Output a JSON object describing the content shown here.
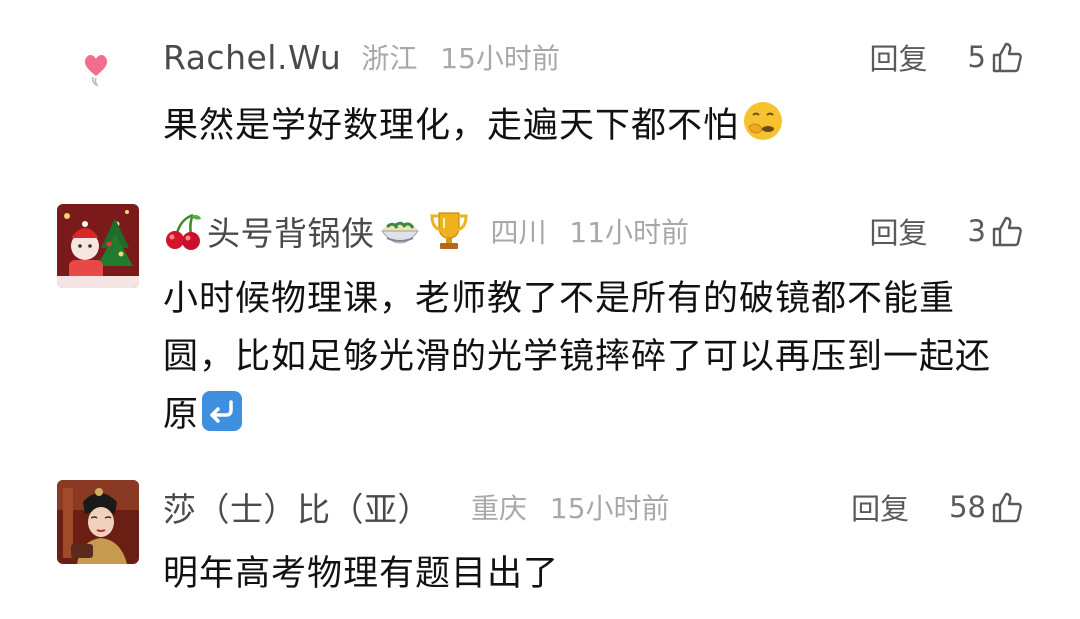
{
  "comments": [
    {
      "username": "Rachel.Wu",
      "location": "浙江",
      "time": "15小时前",
      "reply_label": "回复",
      "likes": "5",
      "text": "果然是学好数理化，走遍天下都不怕",
      "avatar_icon": "heart-icon",
      "trailing_emoji": "thinking-face-icon"
    },
    {
      "username": "头号背锅侠",
      "location": "四川",
      "time": "11小时前",
      "reply_label": "回复",
      "likes": "3",
      "text": "小时候物理课，老师教了不是所有的破镜都不能重圆，比如足够光滑的光学镜摔碎了可以再压到一起还原",
      "avatar_icon": "christmas-avatar",
      "name_emojis": [
        "cherries-icon",
        "noodle-bowl-icon",
        "trophy-icon"
      ],
      "trailing_emoji": "return-arrow-icon"
    },
    {
      "username": "莎（士）比（亚）",
      "location": "重庆",
      "time": "15小时前",
      "reply_label": "回复",
      "likes": "58",
      "text": "明年高考物理有题目出了",
      "avatar_icon": "portrait-avatar"
    }
  ],
  "colors": {
    "username": "#4a4a4a",
    "meta": "#a8a8a8",
    "text": "#111111",
    "heart": "#f26d8f"
  }
}
